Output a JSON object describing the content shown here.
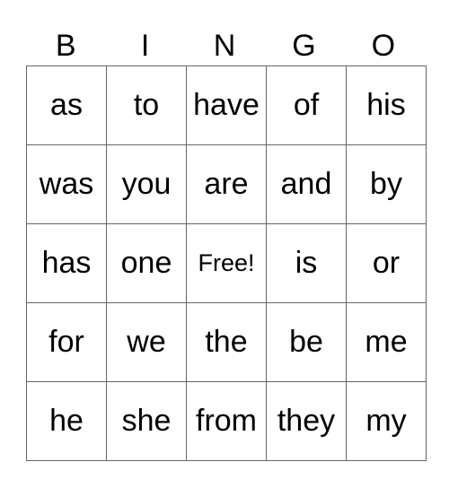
{
  "header": [
    "B",
    "I",
    "N",
    "G",
    "O"
  ],
  "rows": [
    [
      "as",
      "to",
      "have",
      "of",
      "his"
    ],
    [
      "was",
      "you",
      "are",
      "and",
      "by"
    ],
    [
      "has",
      "one",
      "Free!",
      "is",
      "or"
    ],
    [
      "for",
      "we",
      "the",
      "be",
      "me"
    ],
    [
      "he",
      "she",
      "from",
      "they",
      "my"
    ]
  ]
}
